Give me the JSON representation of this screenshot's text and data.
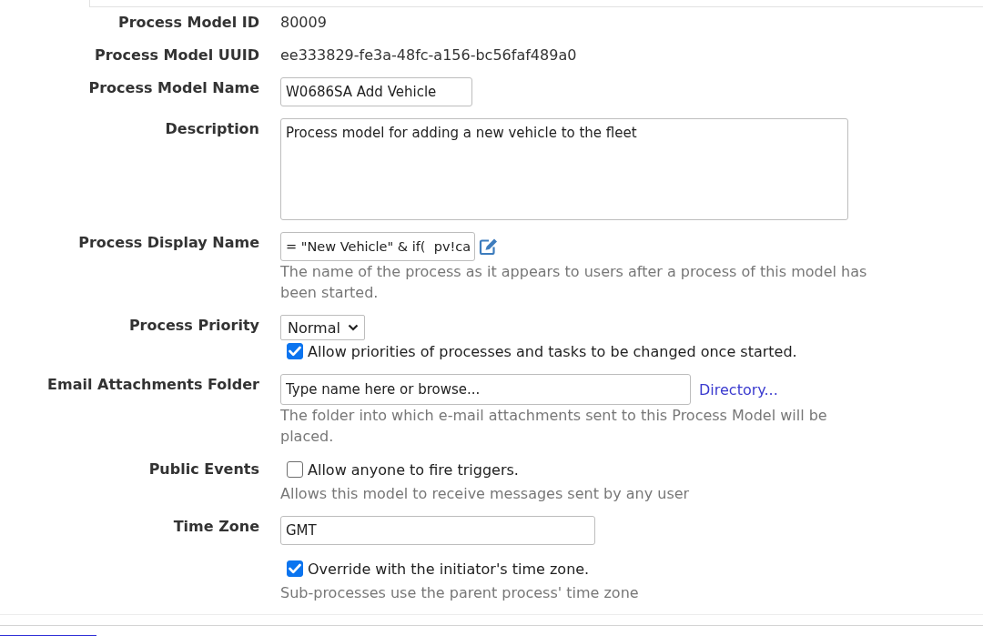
{
  "fields": [
    {
      "kind": "text",
      "label": "Process Model ID",
      "value": "80009"
    },
    {
      "kind": "text",
      "label": "Process Model UUID",
      "value": "ee333829-fe3a-48fc-a156-bc56faf489a0"
    },
    {
      "kind": "input",
      "label": "Process Model Name",
      "value": "W0686SA Add Vehicle"
    },
    {
      "kind": "textarea",
      "label": "Description",
      "value": "Process model for adding a new vehicle to the fleet"
    },
    {
      "kind": "expression",
      "label": "Process Display Name",
      "value": "= \"New Vehicle\" & if(  pv!ca",
      "help": "The name of the process as it appears to users after a process of this model has been started."
    },
    {
      "kind": "select",
      "label": "Process Priority",
      "value": "Normal",
      "checkbox": {
        "label": "Allow priorities of processes and tasks to be changed once started.",
        "checked": true
      }
    },
    {
      "kind": "picker",
      "label": "Email Attachments Folder",
      "value": "Type name here or browse...",
      "link": "Directory...",
      "help": "The folder into which e-mail attachments sent to this Process Model will be placed."
    },
    {
      "kind": "checkbox",
      "label": "Public Events",
      "checkbox": {
        "label": "Allow anyone to fire triggers.",
        "checked": false
      },
      "help": "Allows this model to receive messages sent by any user"
    },
    {
      "kind": "timezone",
      "label": "Time Zone",
      "value": "GMT",
      "checkbox": {
        "label": "Override with the initiator's time zone.",
        "checked": true
      },
      "help": "Sub-processes use the parent process' time zone"
    }
  ]
}
